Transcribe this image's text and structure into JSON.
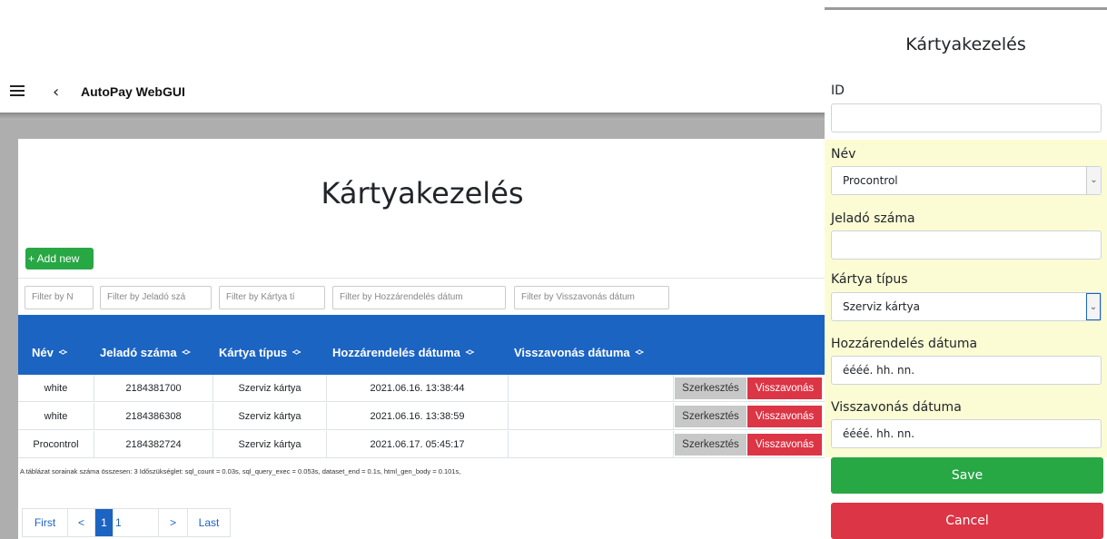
{
  "header": {
    "app_title": "AutoPay WebGUI",
    "menu_icon": "hamburger-menu-icon",
    "back_icon": "chevron-left-icon"
  },
  "main": {
    "title": "Kártyakezelés",
    "add_new_label": "+ Add new",
    "filters": [
      {
        "placeholder": "Filter by N"
      },
      {
        "placeholder": "Filter by Jeladó szá"
      },
      {
        "placeholder": "Filter by Kártya tí"
      },
      {
        "placeholder": "Filter by Hozzárendelés dátum"
      },
      {
        "placeholder": "Filter by Visszavonás dátum"
      }
    ],
    "table": {
      "columns": [
        "Név",
        "Jeladó száma",
        "Kártya típus",
        "Hozzárendelés dátuma",
        "Visszavonás dátuma"
      ],
      "rows": [
        {
          "nev": "white",
          "jelado": "2184381700",
          "tipus": "Szerviz kártya",
          "hozzarendeles": "2021.06.16. 13:38:44",
          "visszavonas": ""
        },
        {
          "nev": "white",
          "jelado": "2184386308",
          "tipus": "Szerviz kártya",
          "hozzarendeles": "2021.06.16. 13:38:59",
          "visszavonas": ""
        },
        {
          "nev": "Procontrol",
          "jelado": "2184382724",
          "tipus": "Szerviz kártya",
          "hozzarendeles": "2021.06.17. 05:45:17",
          "visszavonas": ""
        }
      ],
      "edit_label": "Szerkesztés",
      "revoke_label": "Visszavonás"
    },
    "stats_text": "A táblázat sorainak száma összesen: 3   Időszükséglet: sql_count = 0.03s, sql_query_exec = 0.053s, dataset_end = 0.1s, html_gen_body = 0.101s,",
    "pagination": {
      "first": "First",
      "prev": "<",
      "current": "1",
      "total": "1",
      "next": ">",
      "last": "Last"
    }
  },
  "panel": {
    "title": "Kártyakezelés",
    "fields": {
      "id": {
        "label": "ID",
        "value": ""
      },
      "nev": {
        "label": "Név",
        "value": "Procontrol"
      },
      "jelado": {
        "label": "Jeladó száma",
        "value": ""
      },
      "tipus": {
        "label": "Kártya típus",
        "value": "Szerviz kártya"
      },
      "hozzarendeles": {
        "label": "Hozzárendelés dátuma",
        "value": "éééé. hh. nn."
      },
      "visszavonas": {
        "label": "Visszavonás dátuma",
        "value": "éééé. hh. nn."
      }
    },
    "save_label": "Save",
    "cancel_label": "Cancel"
  },
  "colors": {
    "primary": "#1c64c2",
    "success": "#28a745",
    "danger": "#dc3545",
    "highlight": "#fcfcd4"
  }
}
